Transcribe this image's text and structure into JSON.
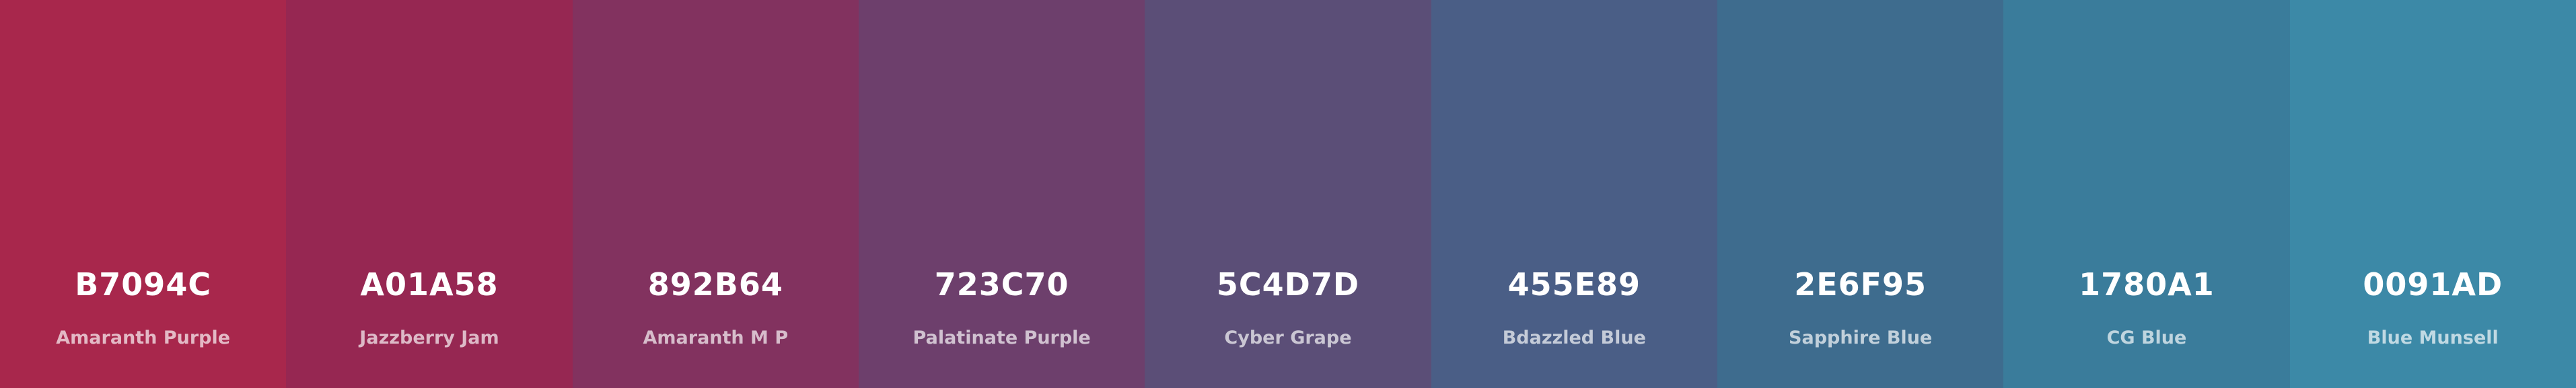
{
  "palette": {
    "swatches": [
      {
        "hex": "B7094C",
        "name": "Amaranth Purple",
        "color": "#A8274C"
      },
      {
        "hex": "A01A58",
        "name": "Jazzberry Jam",
        "color": "#962752"
      },
      {
        "hex": "892B64",
        "name": "Amaranth M P",
        "color": "#82325F"
      },
      {
        "hex": "723C70",
        "name": "Palatinate Purple",
        "color": "#6D3F6C"
      },
      {
        "hex": "5C4D7D",
        "name": "Cyber Grape",
        "color": "#5B4E77"
      },
      {
        "hex": "455E89",
        "name": "Bdazzled Blue",
        "color": "#4A5E86"
      },
      {
        "hex": "2E6F95",
        "name": "Sapphire Blue",
        "color": "#3E6C8E"
      },
      {
        "hex": "1780A1",
        "name": "CG Blue",
        "color": "#3A7C9B"
      },
      {
        "hex": "0091AD",
        "name": "Blue Munsell",
        "color": "#3C89A7"
      }
    ]
  }
}
